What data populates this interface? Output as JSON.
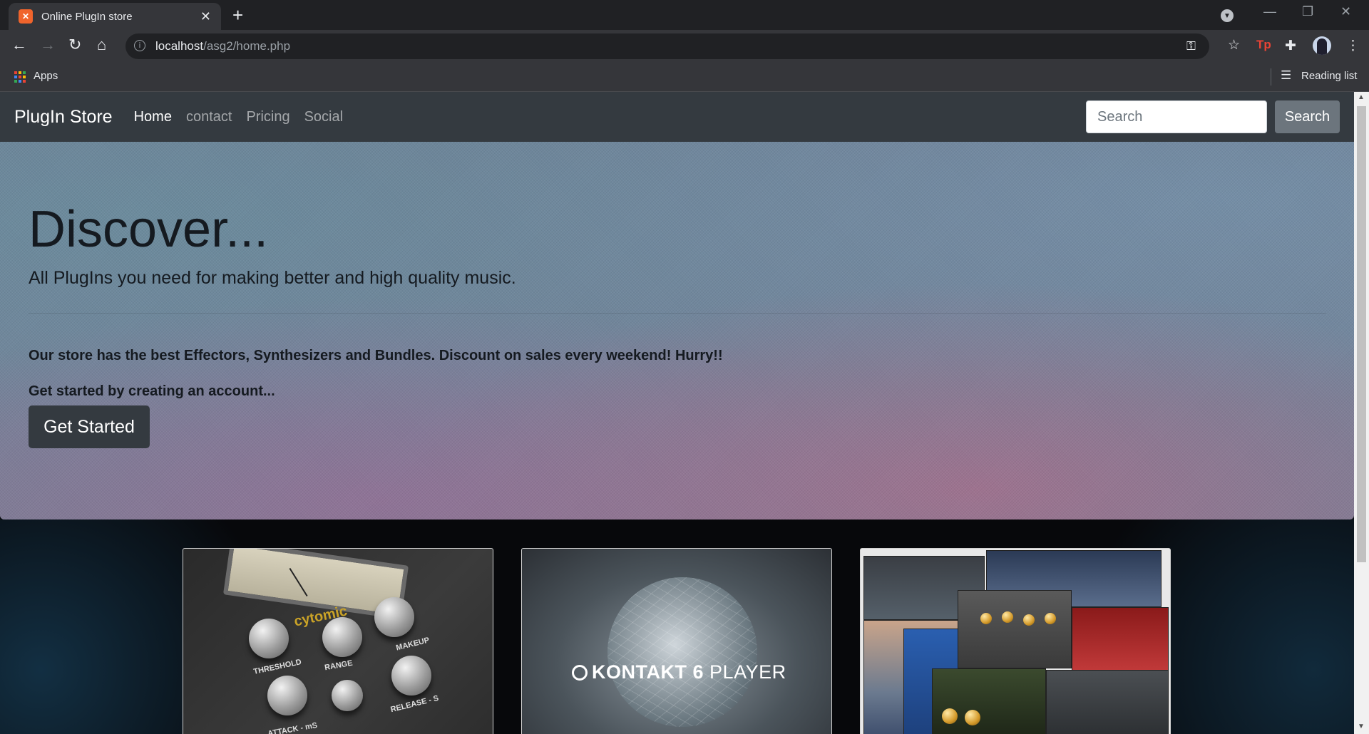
{
  "browser": {
    "tab_title": "Online PlugIn store",
    "tab_favicon": "xampp-icon",
    "url_host": "localhost",
    "url_path": "/asg2/home.php",
    "bookmarks": {
      "apps_label": "Apps",
      "reading_list_label": "Reading list"
    }
  },
  "navbar": {
    "brand": "PlugIn Store",
    "links": [
      {
        "label": "Home",
        "active": true
      },
      {
        "label": "contact",
        "active": false
      },
      {
        "label": "Pricing",
        "active": false
      },
      {
        "label": "Social",
        "active": false
      }
    ],
    "search_placeholder": "Search",
    "search_button": "Search"
  },
  "hero": {
    "title": "Discover...",
    "lead": "All PlugIns you need for making better and high quality music.",
    "text1": "Our store has the best Effectors, Synthesizers and Bundles. Discount on sales every weekend! Hurry!!",
    "text2": "Get started by creating an account...",
    "button": "Get Started"
  },
  "cards": {
    "compressor": {
      "logo": "cytomic",
      "labels": {
        "threshold": "THRESHOLD",
        "range": "RANGE",
        "makeup": "MAKEUP",
        "attack": "ATTACK - mS",
        "release": "RELEASE - S"
      }
    },
    "kontakt": {
      "brand": "KONTAKT",
      "version": "6",
      "suffix": "PLAYER"
    },
    "bundle": {
      "description": "fabfilter-plugin-collage"
    }
  },
  "colors": {
    "navbar_bg": "#343a40",
    "button_secondary": "#6c757d",
    "chrome_bg": "#202124",
    "chrome_toolbar": "#35363a"
  }
}
